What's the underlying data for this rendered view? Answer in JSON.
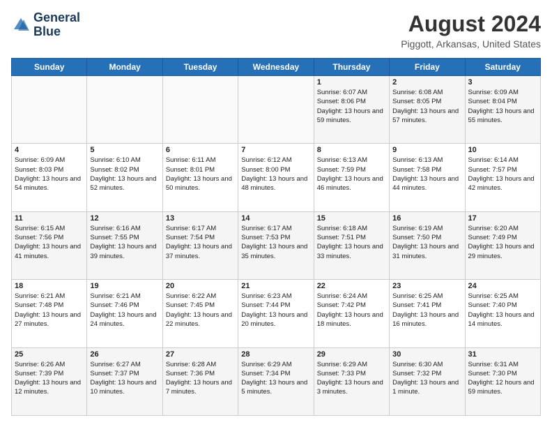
{
  "header": {
    "logo_line1": "General",
    "logo_line2": "Blue",
    "title": "August 2024",
    "subtitle": "Piggott, Arkansas, United States"
  },
  "days_of_week": [
    "Sunday",
    "Monday",
    "Tuesday",
    "Wednesday",
    "Thursday",
    "Friday",
    "Saturday"
  ],
  "weeks": [
    [
      {
        "day": "",
        "info": ""
      },
      {
        "day": "",
        "info": ""
      },
      {
        "day": "",
        "info": ""
      },
      {
        "day": "",
        "info": ""
      },
      {
        "day": "1",
        "info": "Sunrise: 6:07 AM\nSunset: 8:06 PM\nDaylight: 13 hours and 59 minutes."
      },
      {
        "day": "2",
        "info": "Sunrise: 6:08 AM\nSunset: 8:05 PM\nDaylight: 13 hours and 57 minutes."
      },
      {
        "day": "3",
        "info": "Sunrise: 6:09 AM\nSunset: 8:04 PM\nDaylight: 13 hours and 55 minutes."
      }
    ],
    [
      {
        "day": "4",
        "info": "Sunrise: 6:09 AM\nSunset: 8:03 PM\nDaylight: 13 hours and 54 minutes."
      },
      {
        "day": "5",
        "info": "Sunrise: 6:10 AM\nSunset: 8:02 PM\nDaylight: 13 hours and 52 minutes."
      },
      {
        "day": "6",
        "info": "Sunrise: 6:11 AM\nSunset: 8:01 PM\nDaylight: 13 hours and 50 minutes."
      },
      {
        "day": "7",
        "info": "Sunrise: 6:12 AM\nSunset: 8:00 PM\nDaylight: 13 hours and 48 minutes."
      },
      {
        "day": "8",
        "info": "Sunrise: 6:13 AM\nSunset: 7:59 PM\nDaylight: 13 hours and 46 minutes."
      },
      {
        "day": "9",
        "info": "Sunrise: 6:13 AM\nSunset: 7:58 PM\nDaylight: 13 hours and 44 minutes."
      },
      {
        "day": "10",
        "info": "Sunrise: 6:14 AM\nSunset: 7:57 PM\nDaylight: 13 hours and 42 minutes."
      }
    ],
    [
      {
        "day": "11",
        "info": "Sunrise: 6:15 AM\nSunset: 7:56 PM\nDaylight: 13 hours and 41 minutes."
      },
      {
        "day": "12",
        "info": "Sunrise: 6:16 AM\nSunset: 7:55 PM\nDaylight: 13 hours and 39 minutes."
      },
      {
        "day": "13",
        "info": "Sunrise: 6:17 AM\nSunset: 7:54 PM\nDaylight: 13 hours and 37 minutes."
      },
      {
        "day": "14",
        "info": "Sunrise: 6:17 AM\nSunset: 7:53 PM\nDaylight: 13 hours and 35 minutes."
      },
      {
        "day": "15",
        "info": "Sunrise: 6:18 AM\nSunset: 7:51 PM\nDaylight: 13 hours and 33 minutes."
      },
      {
        "day": "16",
        "info": "Sunrise: 6:19 AM\nSunset: 7:50 PM\nDaylight: 13 hours and 31 minutes."
      },
      {
        "day": "17",
        "info": "Sunrise: 6:20 AM\nSunset: 7:49 PM\nDaylight: 13 hours and 29 minutes."
      }
    ],
    [
      {
        "day": "18",
        "info": "Sunrise: 6:21 AM\nSunset: 7:48 PM\nDaylight: 13 hours and 27 minutes."
      },
      {
        "day": "19",
        "info": "Sunrise: 6:21 AM\nSunset: 7:46 PM\nDaylight: 13 hours and 24 minutes."
      },
      {
        "day": "20",
        "info": "Sunrise: 6:22 AM\nSunset: 7:45 PM\nDaylight: 13 hours and 22 minutes."
      },
      {
        "day": "21",
        "info": "Sunrise: 6:23 AM\nSunset: 7:44 PM\nDaylight: 13 hours and 20 minutes."
      },
      {
        "day": "22",
        "info": "Sunrise: 6:24 AM\nSunset: 7:42 PM\nDaylight: 13 hours and 18 minutes."
      },
      {
        "day": "23",
        "info": "Sunrise: 6:25 AM\nSunset: 7:41 PM\nDaylight: 13 hours and 16 minutes."
      },
      {
        "day": "24",
        "info": "Sunrise: 6:25 AM\nSunset: 7:40 PM\nDaylight: 13 hours and 14 minutes."
      }
    ],
    [
      {
        "day": "25",
        "info": "Sunrise: 6:26 AM\nSunset: 7:39 PM\nDaylight: 13 hours and 12 minutes."
      },
      {
        "day": "26",
        "info": "Sunrise: 6:27 AM\nSunset: 7:37 PM\nDaylight: 13 hours and 10 minutes."
      },
      {
        "day": "27",
        "info": "Sunrise: 6:28 AM\nSunset: 7:36 PM\nDaylight: 13 hours and 7 minutes."
      },
      {
        "day": "28",
        "info": "Sunrise: 6:29 AM\nSunset: 7:34 PM\nDaylight: 13 hours and 5 minutes."
      },
      {
        "day": "29",
        "info": "Sunrise: 6:29 AM\nSunset: 7:33 PM\nDaylight: 13 hours and 3 minutes."
      },
      {
        "day": "30",
        "info": "Sunrise: 6:30 AM\nSunset: 7:32 PM\nDaylight: 13 hours and 1 minute."
      },
      {
        "day": "31",
        "info": "Sunrise: 6:31 AM\nSunset: 7:30 PM\nDaylight: 12 hours and 59 minutes."
      }
    ]
  ]
}
